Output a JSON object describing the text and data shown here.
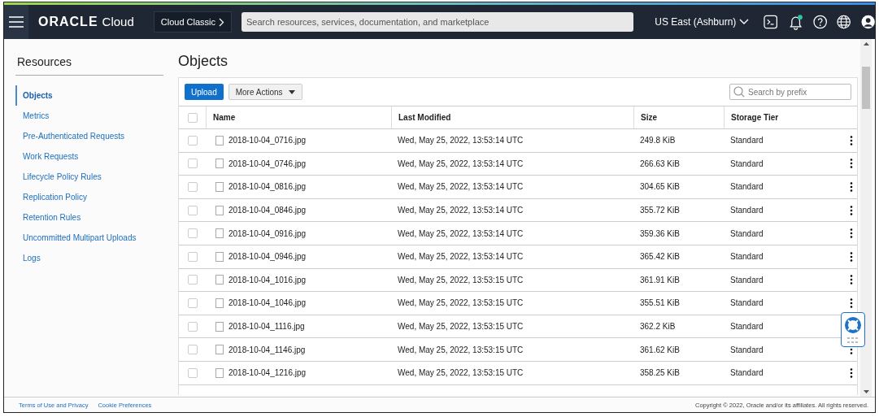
{
  "header": {
    "brand": "ORACLE",
    "product": "Cloud",
    "menu_button": "Cloud Classic",
    "search": {
      "placeholder": "Search resources, services, documentation, and marketplace"
    },
    "region": "US East (Ashburn)",
    "notification_dot": true
  },
  "sidebar": {
    "title": "Resources",
    "items": [
      {
        "label": "Objects",
        "selected": true
      },
      {
        "label": "Metrics",
        "selected": false
      },
      {
        "label": "Pre-Authenticated Requests",
        "selected": false
      },
      {
        "label": "Work Requests",
        "selected": false
      },
      {
        "label": "Lifecycle Policy Rules",
        "selected": false
      },
      {
        "label": "Replication Policy",
        "selected": false
      },
      {
        "label": "Retention Rules",
        "selected": false
      },
      {
        "label": "Uncommitted Multipart Uploads",
        "selected": false
      },
      {
        "label": "Logs",
        "selected": false
      }
    ]
  },
  "page_title": "Objects",
  "toolbar": {
    "primary": "Upload",
    "actions": "More Actions",
    "search": {
      "placeholder": "Search by prefix"
    }
  },
  "table": {
    "select_all": {
      "checked": false
    },
    "columns": [
      "Name",
      "Last Modified",
      "Size",
      "Storage Tier"
    ],
    "rows": [
      {
        "checked": false,
        "name": "2018-10-04_0716.jpg",
        "modified": "Wed, May 25, 2022, 13:53:14 UTC",
        "size": "249.8 KiB",
        "tier": "Standard"
      },
      {
        "checked": false,
        "name": "2018-10-04_0746.jpg",
        "modified": "Wed, May 25, 2022, 13:53:14 UTC",
        "size": "266.63 KiB",
        "tier": "Standard"
      },
      {
        "checked": false,
        "name": "2018-10-04_0816.jpg",
        "modified": "Wed, May 25, 2022, 13:53:14 UTC",
        "size": "304.65 KiB",
        "tier": "Standard"
      },
      {
        "checked": false,
        "name": "2018-10-04_0846.jpg",
        "modified": "Wed, May 25, 2022, 13:53:14 UTC",
        "size": "355.72 KiB",
        "tier": "Standard"
      },
      {
        "checked": false,
        "name": "2018-10-04_0916.jpg",
        "modified": "Wed, May 25, 2022, 13:53:14 UTC",
        "size": "359.36 KiB",
        "tier": "Standard"
      },
      {
        "checked": false,
        "name": "2018-10-04_0946.jpg",
        "modified": "Wed, May 25, 2022, 13:53:14 UTC",
        "size": "365.42 KiB",
        "tier": "Standard"
      },
      {
        "checked": false,
        "name": "2018-10-04_1016.jpg",
        "modified": "Wed, May 25, 2022, 13:53:15 UTC",
        "size": "361.91 KiB",
        "tier": "Standard"
      },
      {
        "checked": false,
        "name": "2018-10-04_1046.jpg",
        "modified": "Wed, May 25, 2022, 13:53:15 UTC",
        "size": "355.51 KiB",
        "tier": "Standard"
      },
      {
        "checked": false,
        "name": "2018-10-04_1116.jpg",
        "modified": "Wed, May 25, 2022, 13:53:15 UTC",
        "size": "362.2 KiB",
        "tier": "Standard"
      },
      {
        "checked": false,
        "name": "2018-10-04_1146.jpg",
        "modified": "Wed, May 25, 2022, 13:53:15 UTC",
        "size": "361.62 KiB",
        "tier": "Standard"
      },
      {
        "checked": false,
        "name": "2018-10-04_1216.jpg",
        "modified": "Wed, May 25, 2022, 13:53:15 UTC",
        "size": "358.25 KiB",
        "tier": "Standard"
      }
    ]
  },
  "footer": {
    "links": [
      "Terms of Use and Privacy",
      "Cookie Preferences"
    ],
    "copyright": "Copyright © 2022, Oracle and/or its affiliates. All rights reserved."
  }
}
